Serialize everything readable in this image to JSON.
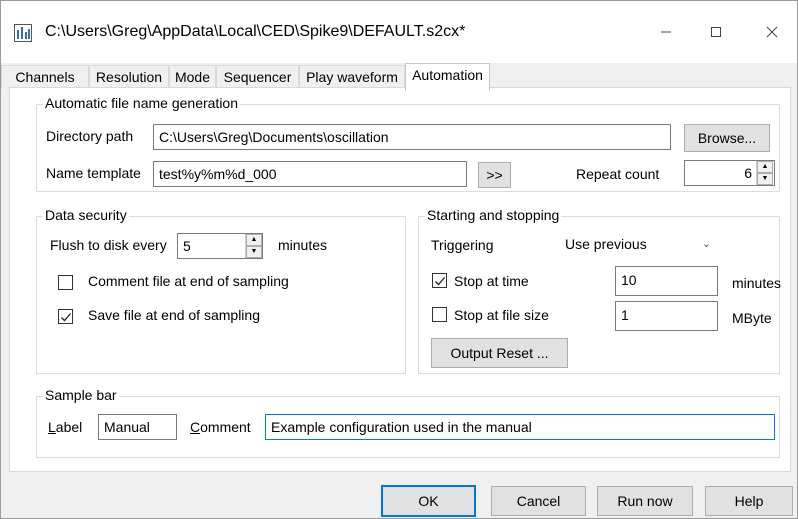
{
  "window": {
    "title": "C:\\Users\\Greg\\AppData\\Local\\CED\\Spike9\\DEFAULT.s2cx*",
    "minimize_icon": "minimize-icon",
    "maximize_icon": "maximize-icon",
    "close_icon": "close-icon"
  },
  "tabs": [
    {
      "label": "Channels"
    },
    {
      "label": "Resolution"
    },
    {
      "label": "Mode"
    },
    {
      "label": "Sequencer"
    },
    {
      "label": "Play waveform"
    },
    {
      "label": "Automation",
      "active": true
    }
  ],
  "auto_name": {
    "group_label": "Automatic file name generation",
    "dir_label": "Directory path",
    "dir_value": "C:\\Users\\Greg\\Documents\\oscillation",
    "browse_label": "Browse...",
    "template_label": "Name template",
    "template_value": "test%y%m%d_000",
    "insert_label": ">>",
    "repeat_label": "Repeat count",
    "repeat_value": "6"
  },
  "security": {
    "group_label": "Data security",
    "flush_label": "Flush to disk every",
    "flush_value": "5",
    "flush_units": "minutes",
    "comment_label": "Comment file at end of sampling",
    "comment_checked": false,
    "save_label": "Save file at end of sampling",
    "save_checked": true
  },
  "start_stop": {
    "group_label": "Starting and stopping",
    "trigger_label": "Triggering",
    "trigger_value": "Use previous",
    "stop_time_label": "Stop at time",
    "stop_time_checked": true,
    "stop_time_value": "10",
    "stop_time_units": "minutes",
    "stop_size_label": "Stop at file size",
    "stop_size_checked": false,
    "stop_size_value": "1",
    "stop_size_units": "MByte",
    "output_reset_label": "Output Reset ..."
  },
  "sample_bar": {
    "group_label": "Sample bar",
    "label_label": "Label",
    "label_value": "Manual",
    "comment_label": "Comment",
    "comment_value": "Example configuration used in the manual"
  },
  "footer": {
    "ok": "OK",
    "cancel": "Cancel",
    "run_now": "Run now",
    "help": "Help"
  },
  "colors": {
    "accent": "#0078d7"
  }
}
